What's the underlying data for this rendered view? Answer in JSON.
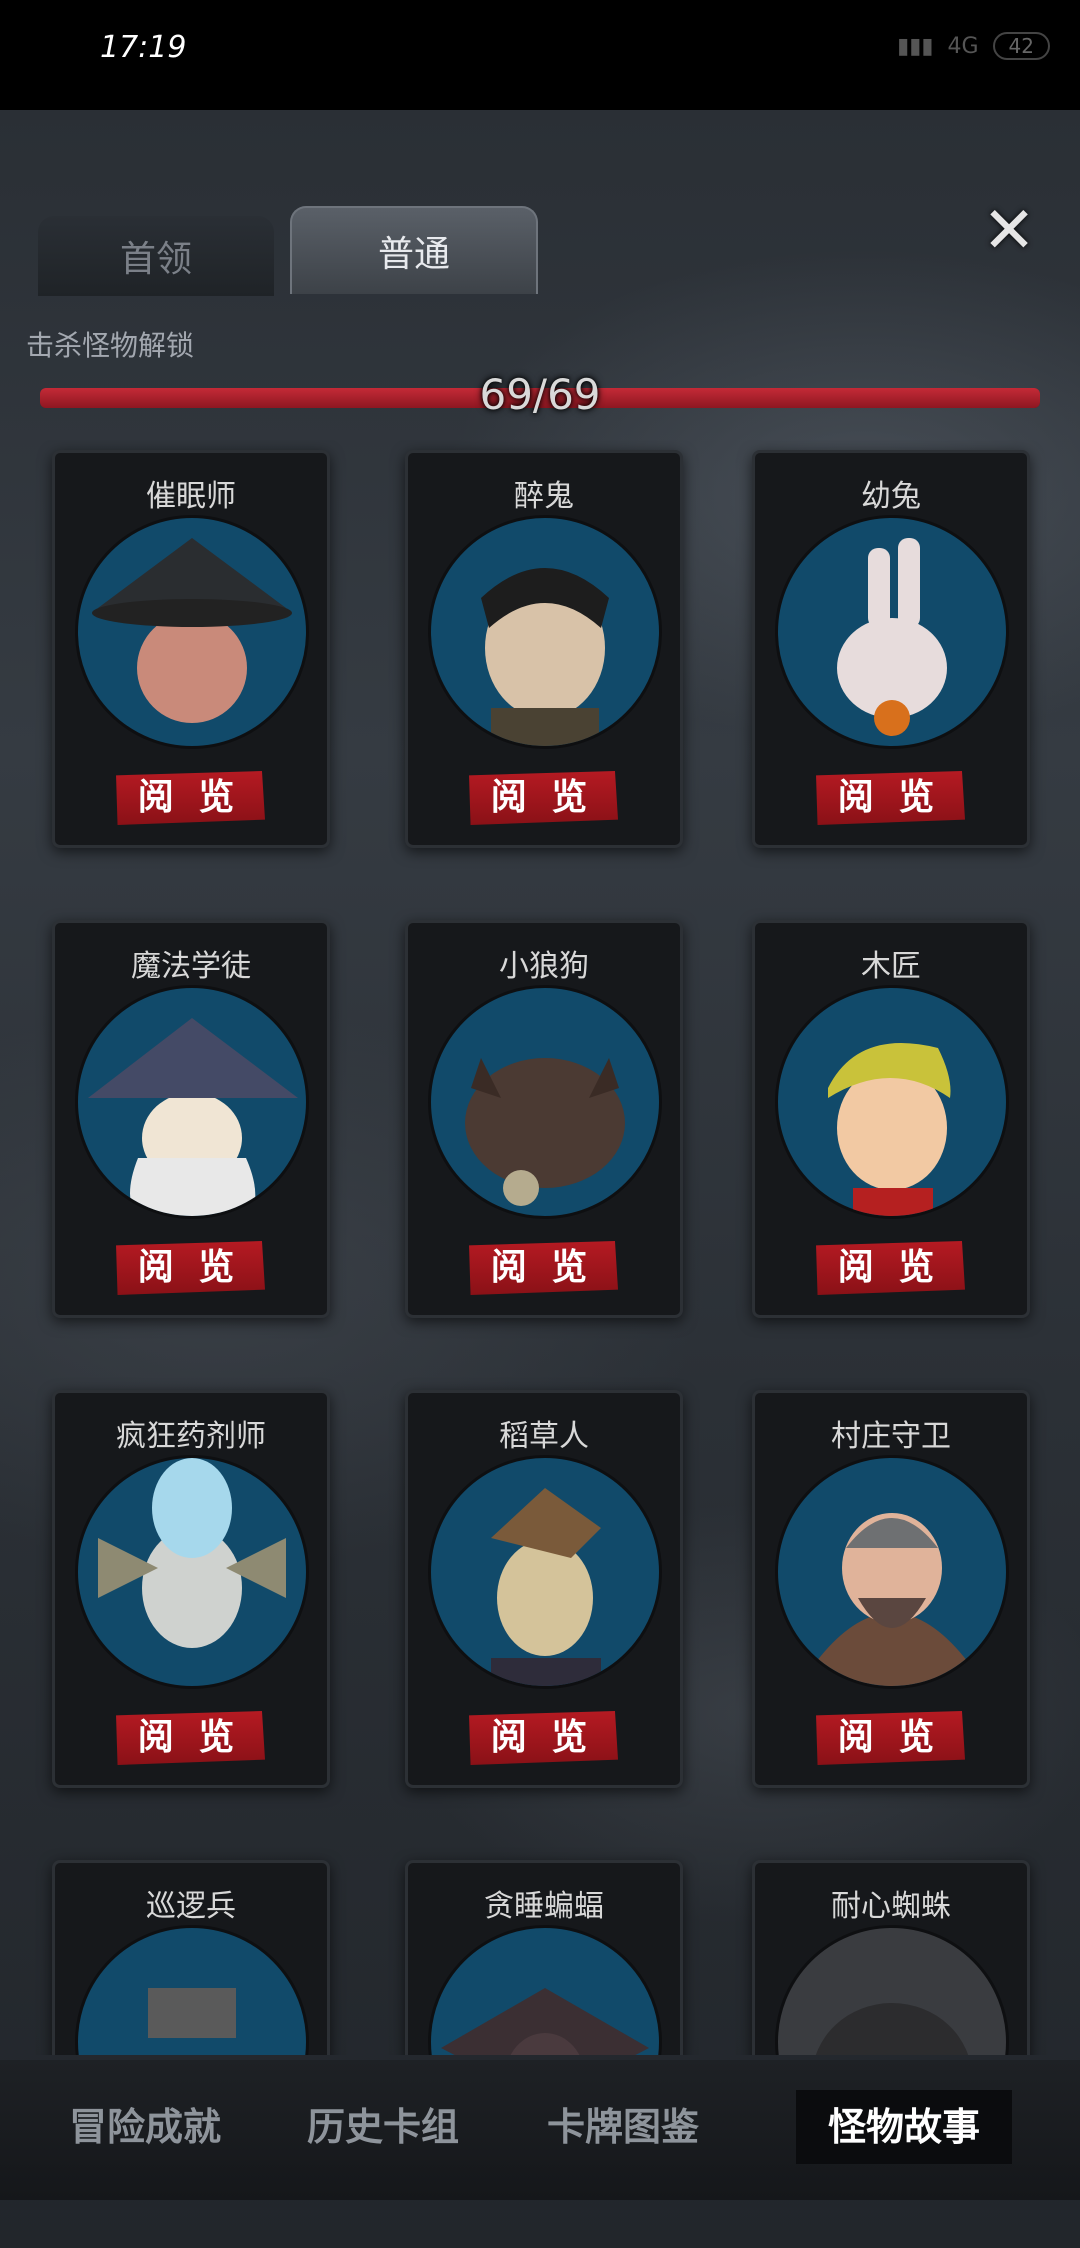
{
  "status_bar": {
    "time": "17:19",
    "network": "4G",
    "battery": "42"
  },
  "tabs": [
    {
      "label": "首领",
      "active": false
    },
    {
      "label": "普通",
      "active": true
    }
  ],
  "close_icon": "close-icon",
  "unlock": {
    "label": "击杀怪物解锁",
    "progress_text": "69/69",
    "unlocked": 69,
    "total": 69
  },
  "read_label": "阅 览",
  "cards": [
    {
      "name": "催眠师"
    },
    {
      "name": "醉鬼"
    },
    {
      "name": "幼兔"
    },
    {
      "name": "魔法学徒"
    },
    {
      "name": "小狼狗"
    },
    {
      "name": "木匠"
    },
    {
      "name": "疯狂药剂师"
    },
    {
      "name": "稻草人"
    },
    {
      "name": "村庄守卫"
    },
    {
      "name": "巡逻兵"
    },
    {
      "name": "贪睡蝙蝠"
    },
    {
      "name": "耐心蜘蛛"
    }
  ],
  "bottom_nav": [
    {
      "label": "冒险成就",
      "active": false
    },
    {
      "label": "历史卡组",
      "active": false
    },
    {
      "label": "卡牌图鉴",
      "active": false
    },
    {
      "label": "怪物故事",
      "active": true
    }
  ],
  "colors": {
    "accent_red": "#b51a22",
    "portrait_bg": "#114a6a",
    "active_tab": "#5a6068"
  }
}
